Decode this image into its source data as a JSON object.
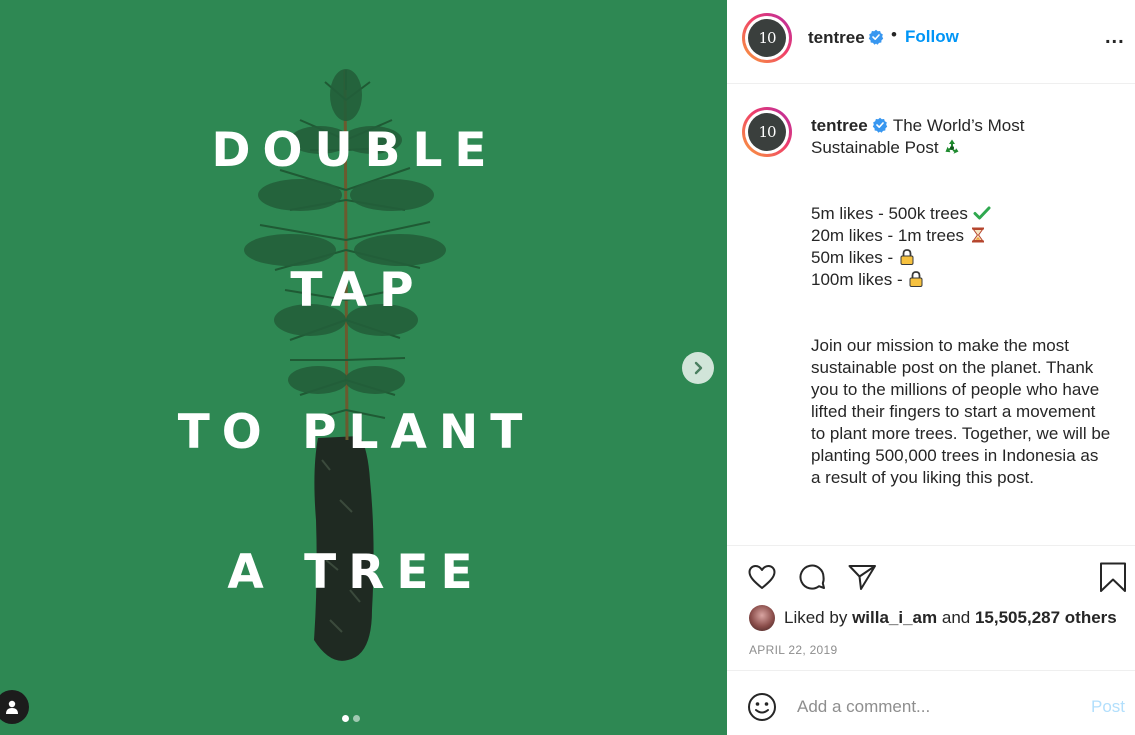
{
  "media": {
    "hero_lines": [
      "DOUBLE",
      "TAP",
      "TO PLANT",
      "A TREE"
    ],
    "carousel": {
      "total_slides": 2,
      "current_slide": 1
    }
  },
  "header": {
    "username": "tentree",
    "avatar_text": "10",
    "bullet": "•",
    "follow_label": "Follow",
    "more_label": "..."
  },
  "caption": {
    "username": "tentree",
    "title": "The World’s Most Sustainable Post",
    "milestones": [
      {
        "text": "5m likes - 500k trees",
        "icon": "check-mark-icon"
      },
      {
        "text": "20m likes - 1m trees",
        "icon": "hourglass-icon"
      },
      {
        "text": "50m likes -",
        "icon": "lock-icon"
      },
      {
        "text": "100m likes -",
        "icon": "lock-icon"
      }
    ],
    "body": "Join our mission to make the most sustainable post on the planet. Thank you to the millions of people who have lifted their fingers to start a movement to plant more trees. Together, we will be planting 500,000 trees in Indonesia as a result of you liking this post."
  },
  "likes": {
    "prefix": "Liked by",
    "liker": "willa_i_am",
    "and": "and",
    "others": "15,505,287 others"
  },
  "date": "APRIL 22, 2019",
  "comment": {
    "placeholder": "Add a comment...",
    "post_label": "Post"
  },
  "colors": {
    "media_background": "#2e8853",
    "link_blue": "#0095f6",
    "post_disabled": "#b2dffc",
    "muted_text": "#8e8e8e"
  }
}
